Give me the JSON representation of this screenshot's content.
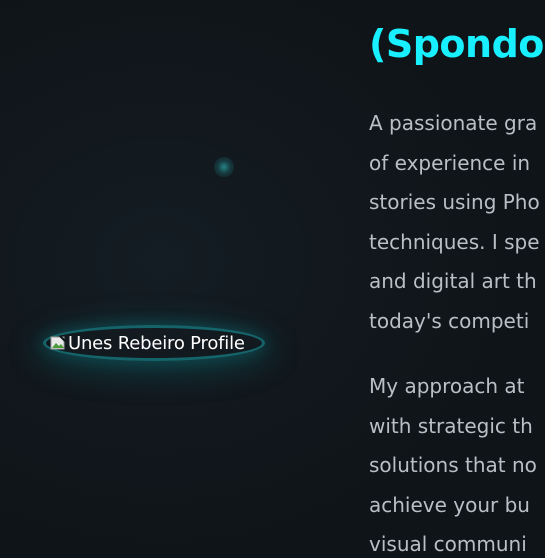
{
  "hero": {
    "profile_image_alt": "Unes Rebeiro Profile",
    "broken_image_icon": "broken-image-icon"
  },
  "about": {
    "title_partial_top": "",
    "title_line": "(Spondo",
    "paragraph1_lines": [
      "A passionate gra",
      "of experience in",
      "stories using Pho",
      "techniques. I spe",
      "and digital art th",
      "today's competi"
    ],
    "paragraph2_lines": [
      "My approach at",
      "with strategic th",
      "solutions that no",
      "achieve your bu",
      "visual communi"
    ]
  },
  "colors": {
    "background": "#10151a",
    "accent": "#19f0ff",
    "body_text": "#b9bfc5",
    "frame_ring": "#14646a"
  }
}
